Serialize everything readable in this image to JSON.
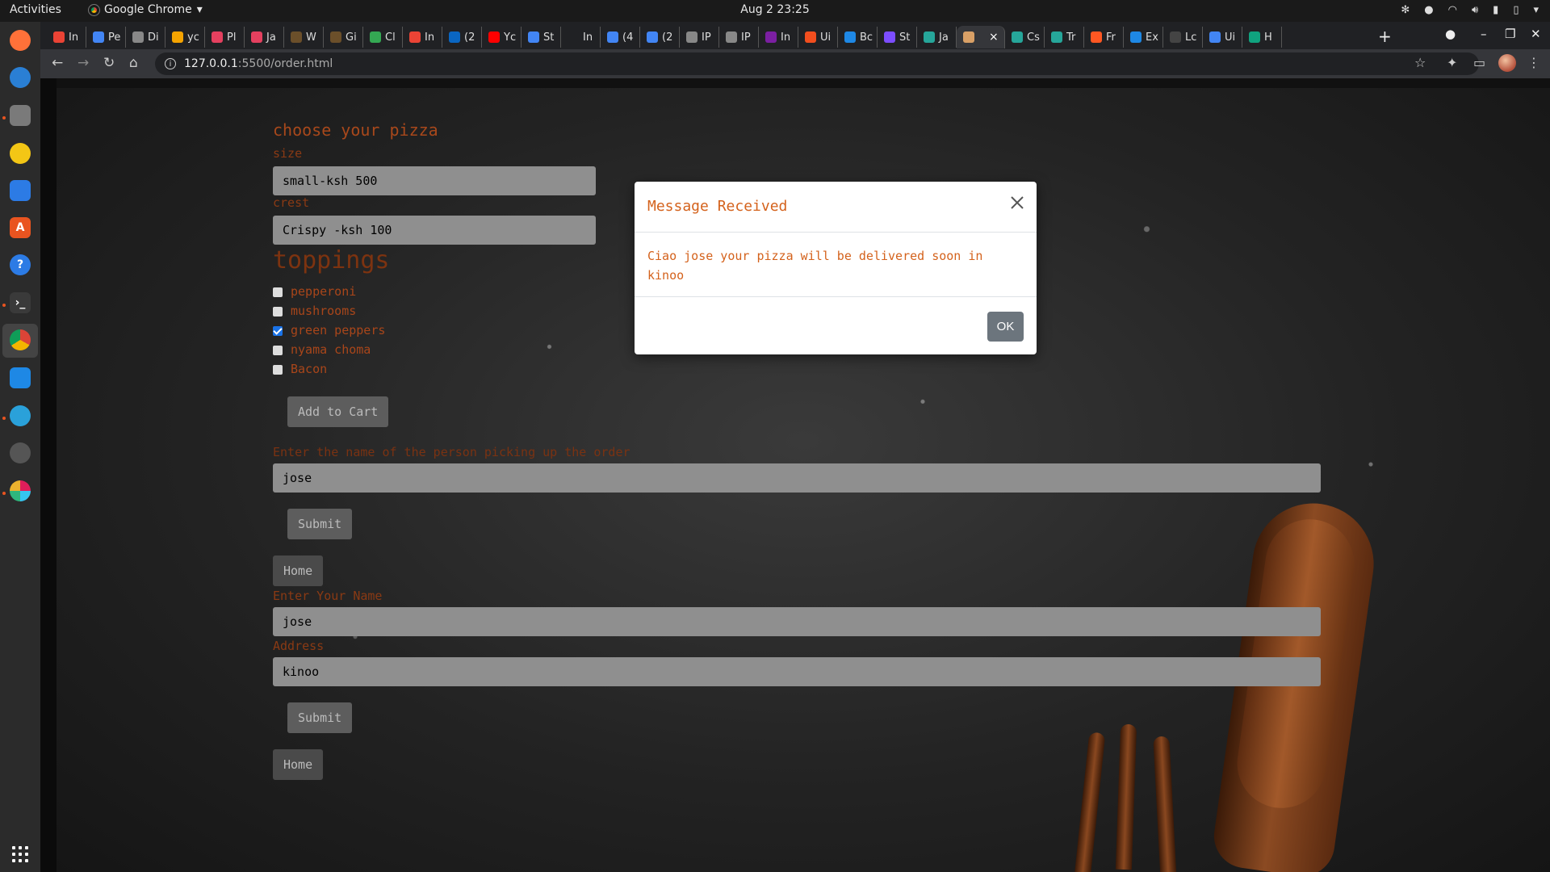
{
  "system": {
    "activities": "Activities",
    "app_name": "Google Chrome",
    "clock": "Aug 2  23:25"
  },
  "tabs": [
    {
      "label": "In",
      "color": "#ea4335"
    },
    {
      "label": "Pe",
      "color": "#4285f4"
    },
    {
      "label": "Di",
      "color": "#888888"
    },
    {
      "label": "yc",
      "color": "#f4a300"
    },
    {
      "label": "Pl",
      "color": "#e4405f"
    },
    {
      "label": "Ja",
      "color": "#e4405f"
    },
    {
      "label": "W",
      "color": "#6b4f2a"
    },
    {
      "label": "Gi",
      "color": "#6b4f2a"
    },
    {
      "label": "Cl",
      "color": "#34a853"
    },
    {
      "label": "In",
      "color": "#ea4335"
    },
    {
      "label": "(2",
      "color": "#0a66c2"
    },
    {
      "label": "Yc",
      "color": "#ff0000"
    },
    {
      "label": "St",
      "color": "#4285f4"
    },
    {
      "label": "In",
      "color": "#202124"
    },
    {
      "label": "(4",
      "color": "#4285f4"
    },
    {
      "label": "(2",
      "color": "#4285f4"
    },
    {
      "label": "IP",
      "color": "#888888"
    },
    {
      "label": "IP",
      "color": "#888888"
    },
    {
      "label": "In",
      "color": "#7b1fa2"
    },
    {
      "label": "Ui",
      "color": "#f24e1e"
    },
    {
      "label": "Bc",
      "color": "#1e88e5"
    },
    {
      "label": "St",
      "color": "#7c4dff"
    },
    {
      "label": "Ja",
      "color": "#26a69a"
    },
    {
      "label": "",
      "color": "#d9a066",
      "active": true
    },
    {
      "label": "Cs",
      "color": "#26a69a"
    },
    {
      "label": "Tr",
      "color": "#26a69a"
    },
    {
      "label": "Fr",
      "color": "#ff5722"
    },
    {
      "label": "Ex",
      "color": "#1e88e5"
    },
    {
      "label": "Lc",
      "color": "#444444"
    },
    {
      "label": "Ui",
      "color": "#4285f4"
    },
    {
      "label": "H",
      "color": "#10a37f"
    }
  ],
  "address": {
    "host": "127.0.0.1",
    "path": ":5500/order.html"
  },
  "form": {
    "heading": "choose your pizza",
    "size_label": "size",
    "size_value": "small-ksh 500",
    "crust_label": "crest",
    "crust_value": "Crispy -ksh 100",
    "toppings_heading": "toppings",
    "toppings": [
      {
        "label": "pepperoni",
        "checked": false
      },
      {
        "label": "mushrooms",
        "checked": false
      },
      {
        "label": "green peppers",
        "checked": true
      },
      {
        "label": "nyama choma",
        "checked": false
      },
      {
        "label": "Bacon",
        "checked": false
      }
    ],
    "add_to_cart": "Add to Cart",
    "pickup_label": "Enter the name of the person picking up the order",
    "pickup_value": "jose",
    "submit1": "Submit",
    "home1": "Home",
    "name_label": "Enter Your Name",
    "name_value": "jose",
    "address_label": "Address",
    "address_value": "kinoo",
    "submit2": "Submit",
    "home2": "Home"
  },
  "modal": {
    "title": "Message Received",
    "body": "Ciao jose your pizza will be delivered soon in kinoo",
    "ok": "OK"
  },
  "colors": {
    "accent": "#d4621c",
    "label": "#b1501e"
  }
}
